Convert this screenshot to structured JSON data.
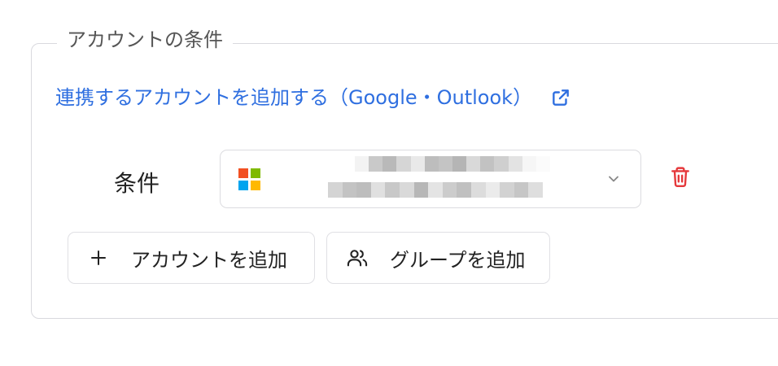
{
  "section": {
    "legend": "アカウントの条件"
  },
  "connect_link": {
    "label": "連携するアカウントを追加する（Google・Outlook）",
    "icon": "external-link-icon",
    "color": "#2f6fe0"
  },
  "condition": {
    "label": "条件",
    "account_select": {
      "provider_icon": "microsoft-logo-icon",
      "value_obscured": true,
      "dropdown_icon": "chevron-down-icon"
    },
    "delete_icon": "trash-icon",
    "delete_color": "#e5383b"
  },
  "actions": {
    "add_account": {
      "label": "アカウントを追加",
      "icon": "plus-icon"
    },
    "add_group": {
      "label": "グループを追加",
      "icon": "users-icon"
    }
  },
  "colors": {
    "border": "#d9d9de",
    "ms_red": "#f25022",
    "ms_green": "#7fba00",
    "ms_blue": "#00a4ef",
    "ms_yellow": "#ffb900"
  }
}
